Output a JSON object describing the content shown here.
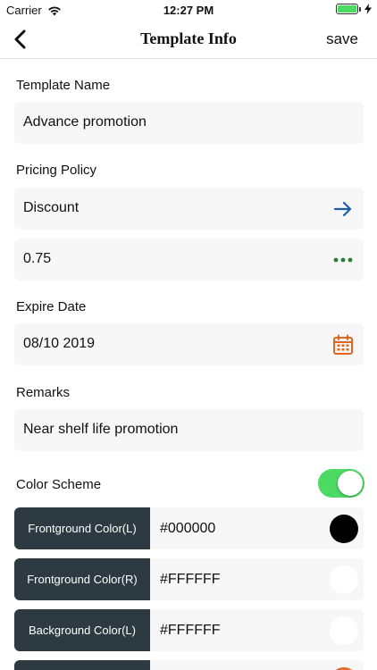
{
  "status_bar": {
    "carrier": "Carrier",
    "time": "12:27 PM"
  },
  "nav": {
    "title": "Template Info",
    "save_label": "save"
  },
  "template_name": {
    "label": "Template Name",
    "value": "Advance promotion"
  },
  "pricing_policy": {
    "label": "Pricing Policy",
    "value": "Discount",
    "amount": "0.75"
  },
  "expire_date": {
    "label": "Expire Date",
    "value": "08/10 2019"
  },
  "remarks": {
    "label": "Remarks",
    "value": "Near shelf life promotion"
  },
  "color_scheme": {
    "label": "Color Scheme",
    "enabled": true,
    "rows": [
      {
        "label": "Frontground Color(L)",
        "value": "#000000",
        "swatch": "#000000"
      },
      {
        "label": "Frontground Color(R)",
        "value": "#FFFFFF",
        "swatch": "#FFFFFF"
      },
      {
        "label": "Background Color(L)",
        "value": "#FFFFFF",
        "swatch": "#FFFFFF"
      },
      {
        "label": "",
        "value": "",
        "swatch": "#E8672A"
      }
    ]
  },
  "colors": {
    "accent_blue": "#1f5fa8",
    "accent_green": "#2e7d32",
    "accent_orange": "#e2651f",
    "toggle_on": "#4cd964",
    "label_bg": "#2d3a42",
    "field_bg": "#f7f7f7"
  },
  "icons": {
    "back": "chevron-left-icon",
    "arrow": "arrow-right-icon",
    "more": "more-icon",
    "calendar": "calendar-icon"
  }
}
